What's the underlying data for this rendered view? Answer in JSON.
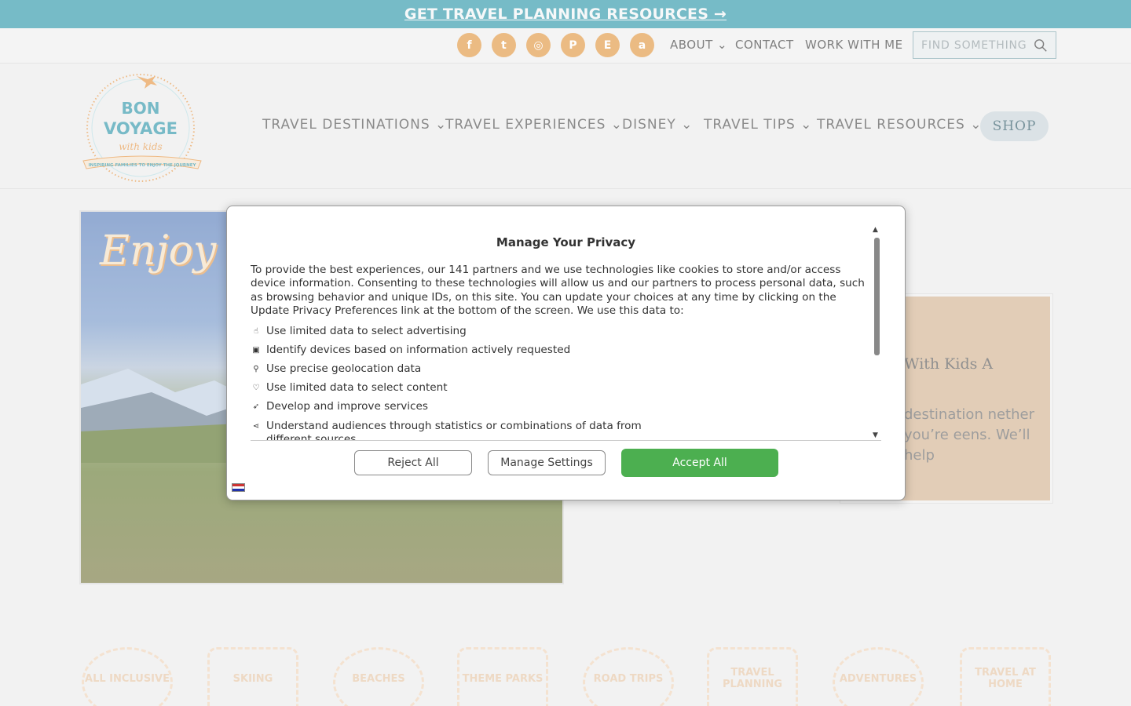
{
  "promo": {
    "label": "GET TRAVEL PLANNING RESOURCES →"
  },
  "top_nav": {
    "social": [
      {
        "name": "facebook-icon",
        "glyph": "f"
      },
      {
        "name": "twitter-icon",
        "glyph": "t"
      },
      {
        "name": "instagram-icon",
        "glyph": "◎"
      },
      {
        "name": "pinterest-icon",
        "glyph": "P"
      },
      {
        "name": "etsy-icon",
        "glyph": "E"
      },
      {
        "name": "amazon-icon",
        "glyph": "a"
      }
    ],
    "about": "ABOUT ⌄",
    "contact": "CONTACT",
    "work_with_me": "WORK WITH ME",
    "search_placeholder": "FIND SOMETHING"
  },
  "logo": {
    "line1": "BON",
    "line2": "VOYAGE",
    "line3": "with kids",
    "tagline": "INSPIRING FAMILIES TO ENJOY THE JOURNEY"
  },
  "main_nav": {
    "items": [
      "TRAVEL DESTINATIONS ⌄",
      "TRAVEL EXPERIENCES ⌄",
      "DISNEY ⌄",
      "TRAVEL TIPS ⌄",
      "TRAVEL RESOURCES ⌄"
    ],
    "shop": "SHOP"
  },
  "hero": {
    "script_text": "Enjoy th"
  },
  "info_card": {
    "heading": "With Kids A",
    "body": "destination nether you’re eens. We’ll help"
  },
  "stamps": [
    "ALL INCLUSIVE",
    "SKIING",
    "BEACHES",
    "THEME PARKS",
    "ROAD TRIPS",
    "TRAVEL PLANNING",
    "ADVENTURES",
    "TRAVEL AT HOME"
  ],
  "stamp_small": "BON VOYAGE",
  "privacy": {
    "title": "Manage Your Privacy",
    "intro": "To provide the best experiences, our 141 partners and we use technologies like cookies to store and/or access device information. Consenting to these technologies will allow us and our partners to process personal data, such as browsing behavior and unique IDs, on this site. You can update your choices at any time by clicking on the Update Privacy Preferences link at the bottom of the screen. We use this data to:",
    "purposes": [
      {
        "icon": "hand-icon",
        "glyph": "☝",
        "text": "Use limited data to select advertising"
      },
      {
        "icon": "device-icon",
        "glyph": "▣",
        "text": "Identify devices based on information actively requested"
      },
      {
        "icon": "location-pin-icon",
        "glyph": "⚲",
        "text": "Use precise geolocation data"
      },
      {
        "icon": "heart-icon",
        "glyph": "♡",
        "text": "Use limited data to select content"
      },
      {
        "icon": "rocket-icon",
        "glyph": "➶",
        "text": "Develop and improve services"
      },
      {
        "icon": "share-icon",
        "glyph": "⋖",
        "text": "Understand audiences through statistics or combinations of data from different sources"
      }
    ],
    "reject": "Reject All",
    "manage": "Manage Settings",
    "accept": "Accept All"
  }
}
